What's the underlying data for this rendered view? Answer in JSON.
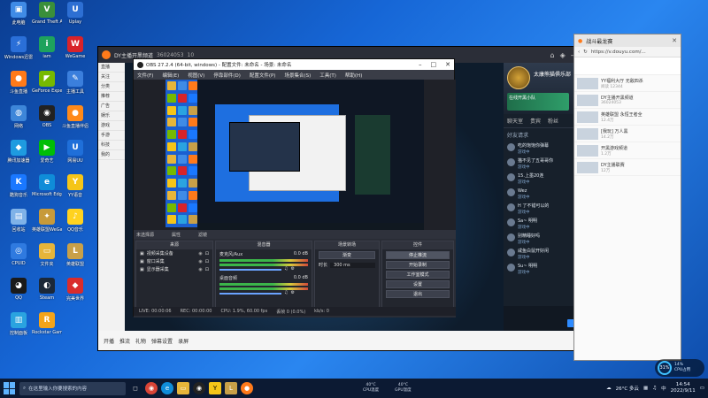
{
  "desktop": {
    "icons": [
      {
        "label": "此电脑",
        "color": "#3f8be6",
        "glyph": "▣"
      },
      {
        "label": "Windows迅雷",
        "color": "#2a6fd8",
        "glyph": "⚡"
      },
      {
        "label": "斗鱼直播",
        "color": "#ff7a1a",
        "glyph": "●"
      },
      {
        "label": "网络",
        "color": "#3d86d9",
        "glyph": "◍"
      },
      {
        "label": "腾讯加速器",
        "color": "#1e9be0",
        "glyph": "◆"
      },
      {
        "label": "酷狗音乐",
        "color": "#1a78ff",
        "glyph": "K"
      },
      {
        "label": "回收站",
        "color": "#7fb2e8",
        "glyph": "▤"
      },
      {
        "label": "CPUID",
        "color": "#2f7ae0",
        "glyph": "◎"
      },
      {
        "label": "QQ",
        "color": "#1a1a1a",
        "glyph": "◕"
      },
      {
        "label": "控制面板",
        "color": "#2aa3e0",
        "glyph": "▥"
      },
      {
        "label": "Grand Theft Auto V",
        "color": "#3a8f3a",
        "glyph": "V"
      },
      {
        "label": "iam",
        "color": "#1ea25c",
        "glyph": "i"
      },
      {
        "label": "GeForce Experience",
        "color": "#76b900",
        "glyph": "◤"
      },
      {
        "label": "OBS",
        "color": "#222222",
        "glyph": "◉"
      },
      {
        "label": "爱奇艺",
        "color": "#00be06",
        "glyph": "▶"
      },
      {
        "label": "Microsoft Edge",
        "color": "#0f8cd8",
        "glyph": "e"
      },
      {
        "label": "英雄联盟WeGame版",
        "color": "#c79a3a",
        "glyph": "✦"
      },
      {
        "label": "文件夹",
        "color": "#e6b53a",
        "glyph": "▭"
      },
      {
        "label": "Steam",
        "color": "#1b2838",
        "glyph": "◐"
      },
      {
        "label": "Rockstar Games",
        "color": "#f4a41a",
        "glyph": "R"
      },
      {
        "label": "Uplay",
        "color": "#2d6fd3",
        "glyph": "U"
      },
      {
        "label": "WeGame",
        "color": "#d8232a",
        "glyph": "W"
      },
      {
        "label": "主播工具",
        "color": "#3b7fdc",
        "glyph": "✎"
      },
      {
        "label": "斗鱼直播伴侣",
        "color": "#ff8a1a",
        "glyph": "●"
      },
      {
        "label": "网易UU",
        "color": "#1f6fd9",
        "glyph": "U"
      },
      {
        "label": "YY语音",
        "color": "#f5c518",
        "glyph": "Y"
      },
      {
        "label": "QQ音乐",
        "color": "#ffd21f",
        "glyph": "♪"
      },
      {
        "label": "英雄联盟",
        "color": "#c8a048",
        "glyph": "L"
      },
      {
        "label": "完美世界",
        "color": "#d92c2c",
        "glyph": "◆"
      }
    ]
  },
  "main_window": {
    "title": "DY主播开黑频道",
    "room_id": "36024053",
    "viewers": "10",
    "level": "1511",
    "left_items": [
      "直播",
      "关注",
      "分类",
      "推荐",
      "广告",
      "娱乐",
      "游戏",
      "手游",
      "科技",
      "我的"
    ],
    "club_name": "太康熊猫俱乐部",
    "green_banner": "在线开黑小队",
    "chat_tabs": [
      "聊天室",
      "贵宾",
      "粉丝"
    ],
    "chat_section": "好友请求",
    "chat_messages": [
      {
        "name": "YY爱你",
        "text": "吃的饱饱你弹幕",
        "sub": "游戏中"
      },
      {
        "name": "猫不见",
        "text": "猫不见了五哥哥你",
        "sub": "游戏中"
      },
      {
        "name": "15",
        "text": "15.上墨20连",
        "sub": "游戏中"
      },
      {
        "name": "Wez",
        "text": "Wez",
        "sub": "游戏中"
      },
      {
        "name": "H",
        "text": "H 了不错可以的",
        "sub": "游戏中"
      },
      {
        "name": "Sa",
        "text": "Sa~ 明明",
        "sub": "游戏中"
      },
      {
        "name": "粗精",
        "text": "别精睡好吗",
        "sub": "游戏中"
      },
      {
        "name": "咸鱼",
        "text": "咸鱼白鼠开好闲",
        "sub": "游戏中"
      },
      {
        "name": "Su",
        "text": "Su~ 明明",
        "sub": "游戏中"
      }
    ],
    "send_label": "发送",
    "bottom_bar": [
      "开播",
      "推流",
      "礼物",
      "弹幕设置",
      "录屏"
    ]
  },
  "obs": {
    "title": "OBS 27.2.4 (64-bit, windows) - 配置文件: 未命名 - 场景: 未命名",
    "menu": [
      "文件(F)",
      "编辑(E)",
      "视图(V)",
      "停靠部件(D)",
      "配置文件(P)",
      "场景集合(S)",
      "工具(T)",
      "帮助(H)"
    ],
    "scene_bar": [
      "未选择源",
      "属性",
      "滤镜"
    ],
    "sources_header": "来源",
    "sources": [
      "视频采集设备",
      "窗口采集",
      "显示器采集"
    ],
    "mixer_header": "混音器",
    "mixer": [
      {
        "name": "麦克风/Aux",
        "db": "0.0 dB"
      },
      {
        "name": "桌面音频",
        "db": "0.0 dB"
      }
    ],
    "transition_header": "场景转场",
    "transition_value": "渐变",
    "duration_label": "时长",
    "duration_value": "300 ms",
    "controls_header": "控件",
    "controls": [
      "停止推流",
      "开始录制",
      "工作室模式",
      "设置",
      "退出"
    ],
    "status": [
      "LIVE: 00:00:06",
      "REC: 00:00:00",
      "CPU: 1.9%, 60.00 fps",
      "丢帧 0 (0.0%)",
      "kb/s: 0"
    ]
  },
  "right_window": {
    "tab": "战斗最龙赛",
    "url": "https://v.douyu.com/...",
    "items": [
      {
        "title": "YY福利大厅 无敌四杀",
        "sub": "阅读 12344"
      },
      {
        "title": "DY主播开黑频道",
        "sub": "36024053"
      },
      {
        "title": "英雄联盟 永恒王者全",
        "sub": "12.4万"
      },
      {
        "title": "[我玩] 万人黑",
        "sub": "14.2万"
      },
      {
        "title": "开黑游戏频道",
        "sub": "1.2万"
      },
      {
        "title": "DY主播联赛",
        "sub": "12万"
      }
    ]
  },
  "cpu_widget": {
    "percent": "31%",
    "line1": "14%",
    "line2": "CPU占用"
  },
  "taskbar": {
    "search_placeholder": "在这里输入你要搜索的内容",
    "cpu_temp1": "40°C",
    "cpu_label1": "CPU温度",
    "cpu_temp2": "40°C",
    "cpu_label2": "GPU温度",
    "weather": "26°C 多云",
    "time": "14:54",
    "date": "2022/9/11",
    "lang": "中"
  }
}
